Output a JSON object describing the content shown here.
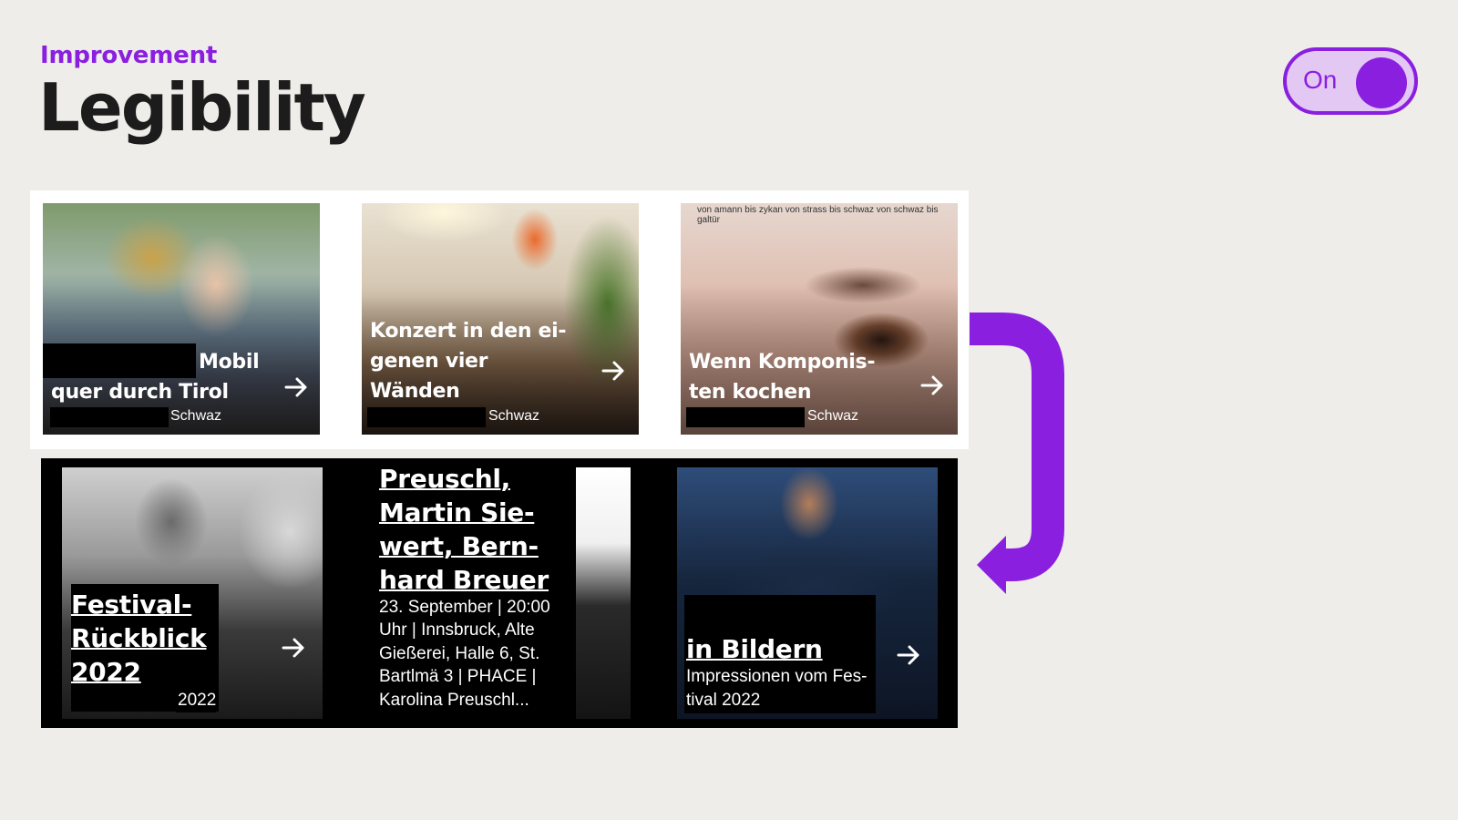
{
  "header": {
    "eyebrow": "Improvement",
    "title": "Legibility"
  },
  "toggle": {
    "label": "On",
    "state": true
  },
  "colors": {
    "accent": "#8a1fe0",
    "background": "#eeede9"
  },
  "before_cards": [
    {
      "title_line1": "Mobil",
      "title_line2": "quer durch Tirol",
      "location": "Schwaz"
    },
    {
      "title_lines": [
        "Konzert in den ei-",
        "genen vier",
        "Wänden"
      ],
      "location": "Schwaz"
    },
    {
      "caption": "von amann bis zykan von strass bis schwaz von schwaz bis galtür",
      "title_lines": [
        "Wenn Komponis-",
        "ten kochen"
      ],
      "location": "Schwaz"
    }
  ],
  "after_cards": [
    {
      "title_lines": [
        "Festival-",
        "Rückblick",
        "2022"
      ],
      "sub": "2022"
    },
    {
      "title_lines": [
        "Preuschl,",
        "Martin Sie-",
        "wert, Bern-",
        "hard Breuer"
      ],
      "sub_lines": [
        "23. September | 20:00",
        "Uhr | Innsbruck, Alte",
        "Gießerei, Halle 6, St.",
        "Bartlmä 3 | PHACE |",
        "Karolina Preuschl..."
      ]
    },
    {
      "title_lines": [
        "in Bildern"
      ],
      "sub_lines": [
        "Impressionen vom Fes-",
        "tival 2022"
      ]
    }
  ],
  "icons": {
    "arrow": "arrow-right-icon",
    "curve": "curved-arrow-icon"
  }
}
